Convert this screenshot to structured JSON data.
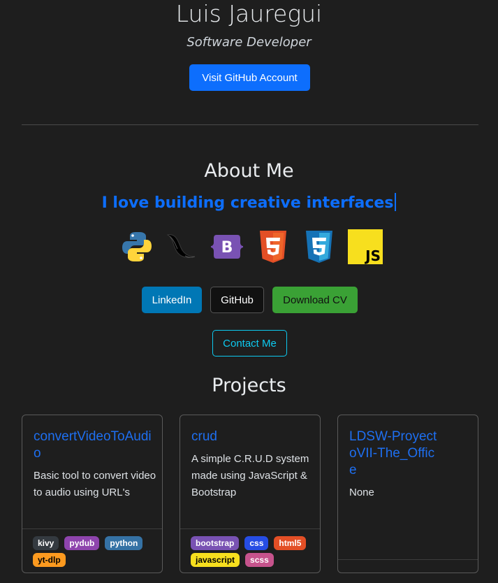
{
  "profile": {
    "name": "Luis Jauregui",
    "role": "Software Developer",
    "github_account_button": "Visit GitHub Account"
  },
  "about": {
    "title": "About Me",
    "typed_text": "I love building creative interfaces",
    "skills_icons": [
      "python-icon",
      "flask-icon",
      "bootstrap-icon",
      "html5-icon",
      "css3-icon",
      "javascript-icon"
    ],
    "links": {
      "linkedin": "LinkedIn",
      "github": "GitHub",
      "download_cv": "Download CV",
      "contact": "Contact Me"
    }
  },
  "projects": {
    "title": "Projects",
    "cards": [
      {
        "title": "convertVideoToAudio",
        "description": "Basic tool to convert video to audio using URL's",
        "tags": [
          {
            "label": "kivy",
            "bg": "#343a40",
            "fg": "#ffffff"
          },
          {
            "label": "pydub",
            "bg": "#8e44ad",
            "fg": "#ffffff"
          },
          {
            "label": "python",
            "bg": "#3572a5",
            "fg": "#ffffff"
          },
          {
            "label": "yt-dlp",
            "bg": "#fd9a1f",
            "fg": "#000000"
          }
        ]
      },
      {
        "title": "crud",
        "description": "A simple C.R.U.D system made using JavaScript & Bootstrap",
        "tags": [
          {
            "label": "bootstrap",
            "bg": "#7952b3",
            "fg": "#ffffff"
          },
          {
            "label": "css",
            "bg": "#264de4",
            "fg": "#ffffff"
          },
          {
            "label": "html5",
            "bg": "#e34f26",
            "fg": "#ffffff"
          },
          {
            "label": "javascript",
            "bg": "#f7df1e",
            "fg": "#000000"
          },
          {
            "label": "scss",
            "bg": "#c6538c",
            "fg": "#ffffff"
          }
        ]
      },
      {
        "title": "LDSW-ProyectoVII-The_Office",
        "description": "None",
        "tags": []
      }
    ]
  },
  "colors": {
    "background": "#1e1e1e",
    "primary": "#0d6efd",
    "linkedin": "#0077b5",
    "cv": "#3aa135",
    "contact": "#0dcaf0"
  }
}
